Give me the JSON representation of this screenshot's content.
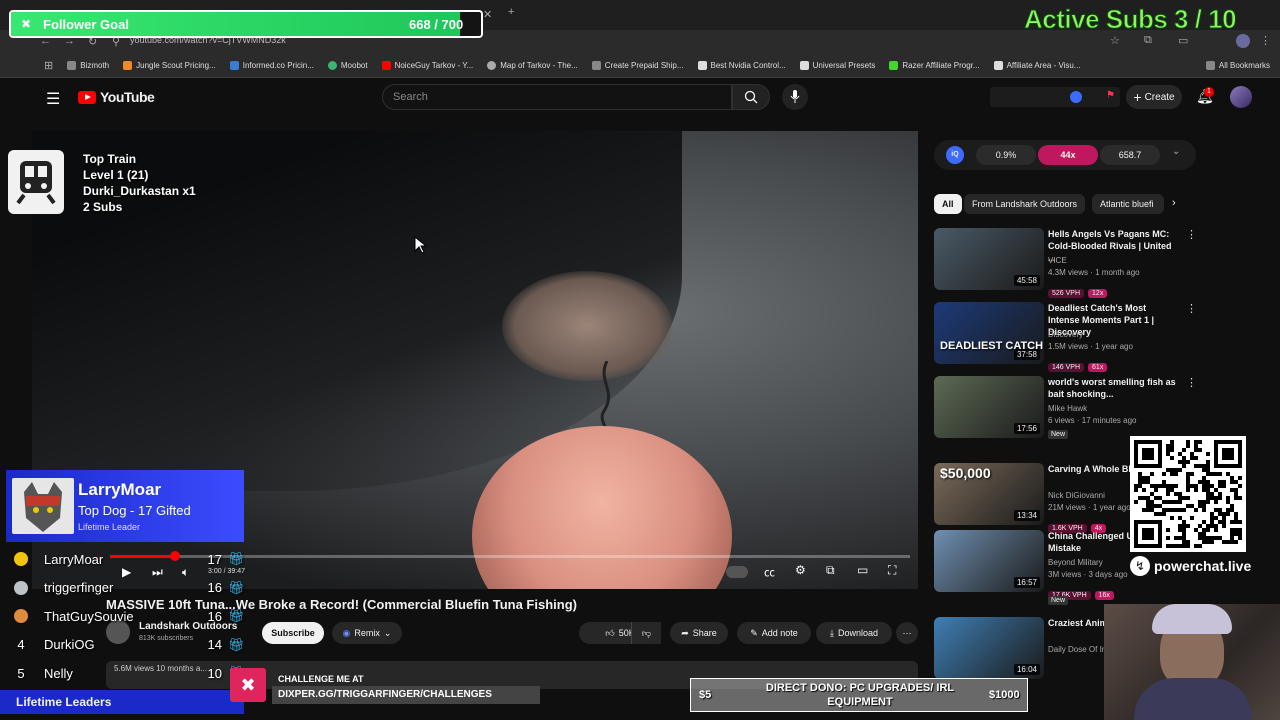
{
  "browser": {
    "url": "youtube.com/watch?v=CjTVWMND32k",
    "bookmarks": [
      "Bizmoth",
      "Jungle Scout Pricing...",
      "Informed.co Pricin...",
      "Moobot",
      "NoiceGuy Tarkov - Y...",
      "Map of Tarkov - The...",
      "Create Prepaid Ship...",
      "Best Nvidia Control...",
      "Universal Presets",
      "Razer Affiliate Progr...",
      "Affiliate Area - Visu..."
    ],
    "all_bookmarks": "All Bookmarks"
  },
  "youtube": {
    "logo": "YouTube",
    "search_placeholder": "Search",
    "create": "Create",
    "notif_count": "1",
    "video": {
      "time": "3:00 / 39:47",
      "title": "MASSIVE 10ft Tuna...We Broke a Record! (Commercial Bluefin Tuna Fishing)",
      "channel": "Landshark Outdoors",
      "subscribers": "813K subscribers",
      "subscribe": "Subscribe",
      "remix": "Remix",
      "likes": "50K",
      "share": "Share",
      "add_note": "Add note",
      "download": "Download",
      "views_meta": "5.6M views  10 months a..."
    },
    "ext_stats": [
      "0.9%",
      "44x",
      "658.7"
    ],
    "chips": [
      "All",
      "From Landshark Outdoors",
      "Atlantic bluefi"
    ],
    "recommendations": [
      {
        "title": "Hells Angels Vs Pagans MC: Cold-Blooded Rivals | United ...",
        "channel": "VICE",
        "meta": "4.3M views · 1 month ago",
        "vph": "526 VPH",
        "mult": "12x",
        "duration": "45:58",
        "color": "#4a5a66"
      },
      {
        "title": "Deadliest Catch's Most Intense Moments Part 1 | Discovery",
        "channel": "Discovery",
        "meta": "1.5M views · 1 year ago",
        "vph": "146 VPH",
        "mult": "61x",
        "duration": "37:58",
        "thumb_text": "DEADLIEST CATCH",
        "color": "#1c3a7a"
      },
      {
        "title": "world's worst smelling fish as bait shocking...",
        "channel": "Mike Hawk",
        "meta": "6 views · 17 minutes ago",
        "badge": "New",
        "duration": "17:56",
        "color": "#5d6a55"
      },
      {
        "title": "Carving A Whole Bluefin...",
        "channel": "Nick DiGiovanni",
        "meta": "21M views · 1 year ago",
        "vph": "1.6K VPH",
        "mult": "4x",
        "duration": "13:34",
        "thumb_text": "$50,000",
        "color": "#7a6a5a"
      },
      {
        "title": "China Challenged U... — Big Mistake",
        "channel": "Beyond Military",
        "meta": "3M views · 3 days ago",
        "badge": "New",
        "vph": "17.6K VPH",
        "mult": "16x",
        "duration": "16:57",
        "color": "#6f8fb0"
      },
      {
        "title": "Craziest Animal... All Time",
        "channel": "Daily Dose Of In...",
        "meta": "",
        "duration": "16:04",
        "color": "#3f7fb5"
      }
    ]
  },
  "overlay": {
    "follower_goal": {
      "label": "Follower Goal",
      "count": "668 / 700",
      "current": 668,
      "target": 700
    },
    "active_subs": "Active Subs  3 / 10",
    "top_train": [
      "Top Train",
      "Level 1  (21)",
      "Durki_Durkastan x1",
      "2 Subs"
    ],
    "leader_card": {
      "name": "LarryMoar",
      "subtitle": "Top Dog - 17 Gifted",
      "tag": "Lifetime Leader"
    },
    "leaderboard": [
      {
        "rank": "",
        "name": "LarryMoar",
        "count": "17"
      },
      {
        "rank": "",
        "name": "triggerfinger",
        "count": "16"
      },
      {
        "rank": "",
        "name": "ThatGuySouvie",
        "count": "16"
      },
      {
        "rank": "4",
        "name": "DurkiOG",
        "count": "14"
      },
      {
        "rank": "5",
        "name": "Nelly",
        "count": "10"
      }
    ],
    "lifetime_leaders": "Lifetime Leaders",
    "challenge_line1": "CHALLENGE ME AT",
    "challenge_line2": "DIXPER.GG/TRIGGARFINGER/CHALLENGES",
    "dono": {
      "left": "$5",
      "text": "DIRECT DONO: PC UPGRADES/ IRL EQUIPMENT",
      "right": "$1000"
    },
    "powerchat": "powerchat.live"
  }
}
